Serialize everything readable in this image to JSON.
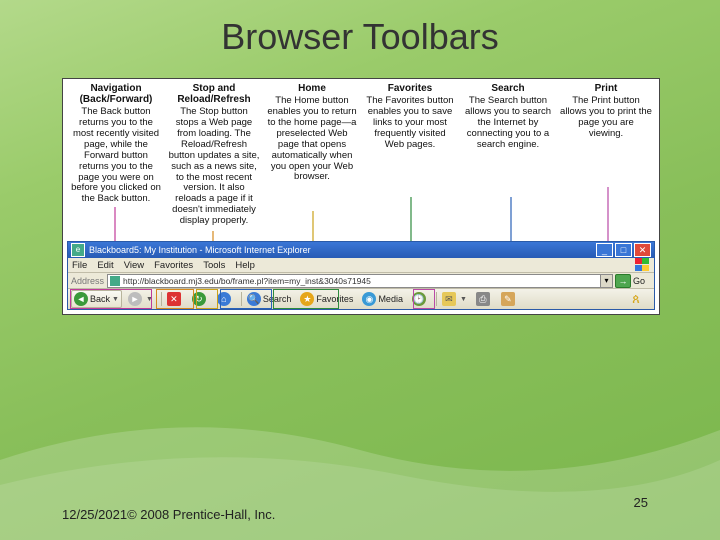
{
  "slide": {
    "title": "Browser Toolbars",
    "footer": "12/25/2021© 2008 Prentice-Hall, Inc.",
    "page_number": "25"
  },
  "columns": [
    {
      "header": "Navigation\n(Back/Forward)",
      "body": "The Back button returns you to the most recently visited page, while the Forward button returns you to the page you were on before you clicked on the Back button."
    },
    {
      "header": "Stop and\nReload/Refresh",
      "body": "The Stop button stops a Web page from loading. The Reload/Refresh button updates a site, such as a news site, to the most recent version. It also reloads a page if it doesn't immediately display properly."
    },
    {
      "header": "Home",
      "body": "The Home button enables you to return to the home page—a preselected Web page that opens automatically when you open your Web browser."
    },
    {
      "header": "Favorites",
      "body": "The Favorites button enables you to save links to your most frequently visited Web pages."
    },
    {
      "header": "Search",
      "body": "The Search button allows you to search the Internet by connecting you to a search engine."
    },
    {
      "header": "Print",
      "body": "The Print button allows you to print the page you are viewing."
    }
  ],
  "window": {
    "title": "Blackboard5: My Institution - Microsoft Internet Explorer",
    "menu": [
      "File",
      "Edit",
      "View",
      "Favorites",
      "Tools",
      "Help"
    ],
    "address_label": "Address",
    "address_value": "http://blackboard.mj3.edu/bo/frame.pl?item=my_inst&3040s71945",
    "go_label": "Go",
    "toolbar": {
      "back": "Back",
      "search": "Search",
      "favorites": "Favorites",
      "media": "Media"
    }
  },
  "colors": {
    "navigation": "#c03a9a",
    "stop": "#d48a1e",
    "home": "#caa21a",
    "favorites": "#2e8b3e",
    "search": "#2a62b8",
    "print": "#b94aa6"
  }
}
